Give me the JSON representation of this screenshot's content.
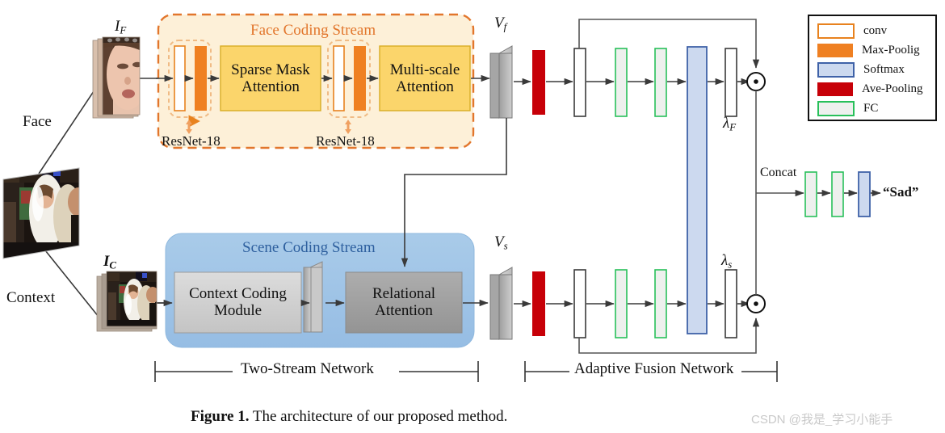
{
  "figure": {
    "caption_bold": "Figure 1.",
    "caption_rest": " The architecture of our proposed method.",
    "watermark": "CSDN @我是_学习小能手"
  },
  "legend": {
    "items": [
      {
        "label": "conv",
        "swatch": "conv",
        "fill": "#ffffff",
        "stroke": "#e8821e"
      },
      {
        "label": "Max-Poolig",
        "swatch": "max",
        "fill": "#ef8022",
        "stroke": "#ef8022"
      },
      {
        "label": "Softmax",
        "swatch": "softmax",
        "fill": "#ccd9ef",
        "stroke": "#3f62a8"
      },
      {
        "label": "Ave-Pooling",
        "swatch": "ave",
        "fill": "#c70008",
        "stroke": "#c70008"
      },
      {
        "label": "FC",
        "swatch": "fc",
        "fill": "#eef0ee",
        "stroke": "#28c05a"
      }
    ]
  },
  "inputs": {
    "source_label": "",
    "face_arrow_label": "Face",
    "context_arrow_label": "Context",
    "face_symbol": "I",
    "face_symbol_sub": "F",
    "context_symbol": "I",
    "context_symbol_sub": "C"
  },
  "face_stream": {
    "title": "Face Coding Stream",
    "title_color": "#e2762c",
    "border_color": "#e2762c",
    "fill_color": "#fdf0d8",
    "backbone_label_1": "ResNet-18",
    "backbone_label_2": "ResNet-18",
    "module_1_line1": "Sparse Mask",
    "module_1_line2": "Attention",
    "module_2_line1": "Multi-scale",
    "module_2_line2": "Attention",
    "module_fill": "#fbd56b",
    "module_stroke": "#d8ad25"
  },
  "scene_stream": {
    "title": "Scene Coding Stream",
    "title_color": "#2d5f9e",
    "fill_color": "#a8c8e8",
    "module_1_line1": "Context Coding",
    "module_1_line2": "Module",
    "module_1_fill": "#d2d2d2",
    "module_2_line1": "Relational",
    "module_2_line2": "Attention",
    "module_2_fill": "#a6a6a6"
  },
  "features": {
    "face_feature": "V",
    "face_feature_sub": "f",
    "scene_feature": "V",
    "scene_feature_sub": "s"
  },
  "fusion": {
    "lambda_face": "λ",
    "lambda_face_sub": "F",
    "lambda_scene": "λ",
    "lambda_scene_sub": "s",
    "concat_label": "Concat",
    "output_label": "“Sad”",
    "multiply_symbol": "⊙"
  },
  "brackets": {
    "two_stream": "Two-Stream Network",
    "adaptive_fusion": "Adaptive Fusion Network"
  },
  "chart_data": {
    "type": "diagram",
    "title": "The architecture of our proposed method",
    "nodes": [
      "Source Image",
      "Face I_F",
      "Context I_C",
      "ResNet-18 (conv+maxpool)",
      "Sparse Mask Attention",
      "ResNet-18 (conv+maxpool)",
      "Multi-scale Attention",
      "V_f",
      "Context Coding Module",
      "Relational Attention",
      "V_s",
      "Ave-Pooling",
      "conv",
      "FC",
      "FC",
      "Softmax",
      "conv (lambda_F)",
      "multiply",
      "Ave-Pooling",
      "conv",
      "FC",
      "FC",
      "Softmax",
      "conv (lambda_s)",
      "multiply",
      "Concat",
      "FC",
      "FC",
      "Softmax",
      "Sad"
    ]
  }
}
